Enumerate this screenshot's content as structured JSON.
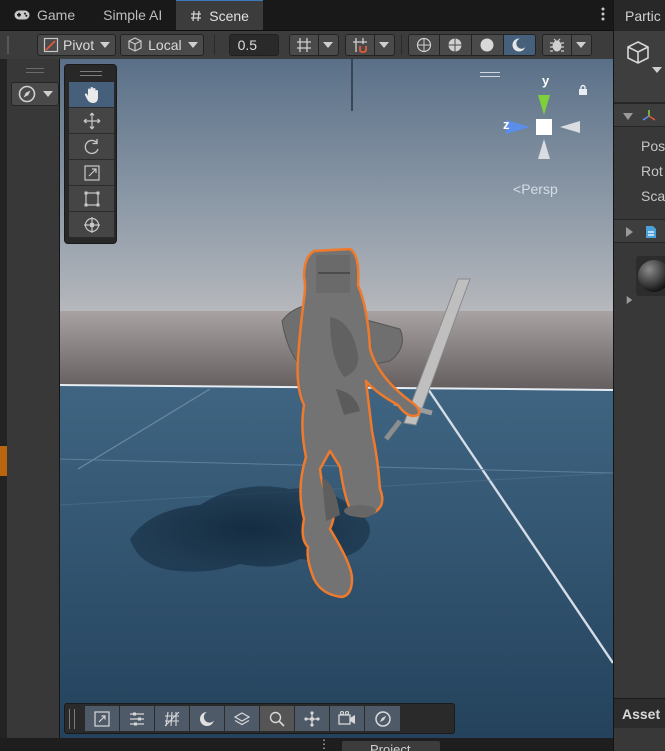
{
  "scene_view": {
    "tabs": [
      {
        "label": "Game",
        "icon": "gamepad-icon"
      },
      {
        "label": "Simple AI",
        "icon": ""
      },
      {
        "label": "Scene",
        "icon": "hash-icon"
      }
    ],
    "active_tab": "Scene"
  },
  "toolbar": {
    "pivot_label": "Pivot",
    "space_label": "Local",
    "snap_value": "0.5"
  },
  "gizmo": {
    "axis_y": "y",
    "axis_z": "z",
    "projection_label": "Persp"
  },
  "inspector": {
    "tab_label": "Partic",
    "rows": [
      "Pos",
      "Rot",
      "Sca"
    ],
    "assets_label": "Asset"
  },
  "bottom_tabs": {
    "project_label": "Project"
  },
  "colors": {
    "selection_outline": "#f07a2c",
    "active_tool": "#46607c",
    "tab_accent": "#3a79bb"
  }
}
